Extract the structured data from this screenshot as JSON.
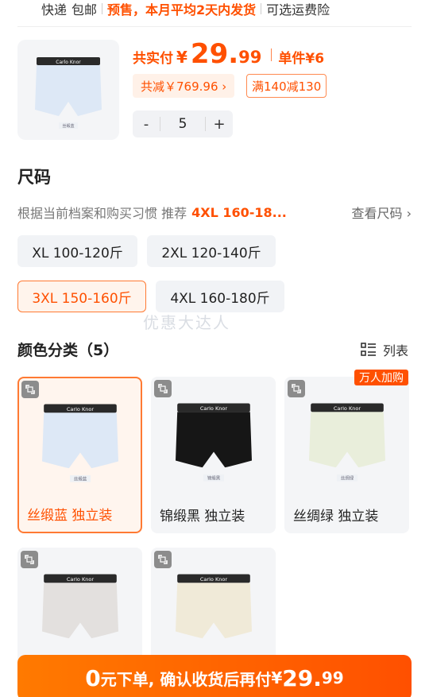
{
  "shipping": {
    "delivery": "快递",
    "free": "包邮",
    "presale": "预售，本月平均2天内发货",
    "insurance": "可选运费险"
  },
  "product": {
    "price_label": "共实付",
    "currency": "¥",
    "price_int": "29.",
    "price_dec": "99",
    "unit_price": "单件¥6",
    "save": "共减￥769.96 ›",
    "coupon": "满140减130",
    "quantity": "5",
    "minus": "-",
    "plus": "+",
    "thumb_tag": "丝缎蓝",
    "brand": "Carlo Knor"
  },
  "size": {
    "title": "尺码",
    "rec_prefix": "根据当前档案和购买习惯 推荐",
    "rec_value": "4XL 160-18...",
    "view_link": "查看尺码 ›",
    "options": [
      "XL 100-120斤",
      "2XL 120-140斤",
      "3XL 150-160斤",
      "4XL 160-180斤"
    ],
    "selected": "3XL 150-160斤"
  },
  "watermark": "优惠大达人",
  "colors": {
    "title": "颜色分类（5）",
    "toggle": "列表",
    "badge": "万人加购",
    "items": [
      {
        "label": "丝缎蓝 独立装",
        "tag": "丝缎蓝",
        "color": "#dde8f6"
      },
      {
        "label": "锦缎黑 独立装",
        "tag": "锦缎黑",
        "color": "#161616"
      },
      {
        "label": "丝绸绿 独立装",
        "tag": "丝绸绿",
        "color": "#e9eedb"
      },
      {
        "label": "",
        "tag": "",
        "color": "#e3e0de"
      },
      {
        "label": "",
        "tag": "",
        "color": "#f0ead8"
      }
    ]
  },
  "cta": {
    "amount": "0",
    "text": "元下单, 确认收货后再付",
    "currency": "¥",
    "price_int": "29.",
    "price_dec": "99"
  },
  "accent": "#ff5000"
}
